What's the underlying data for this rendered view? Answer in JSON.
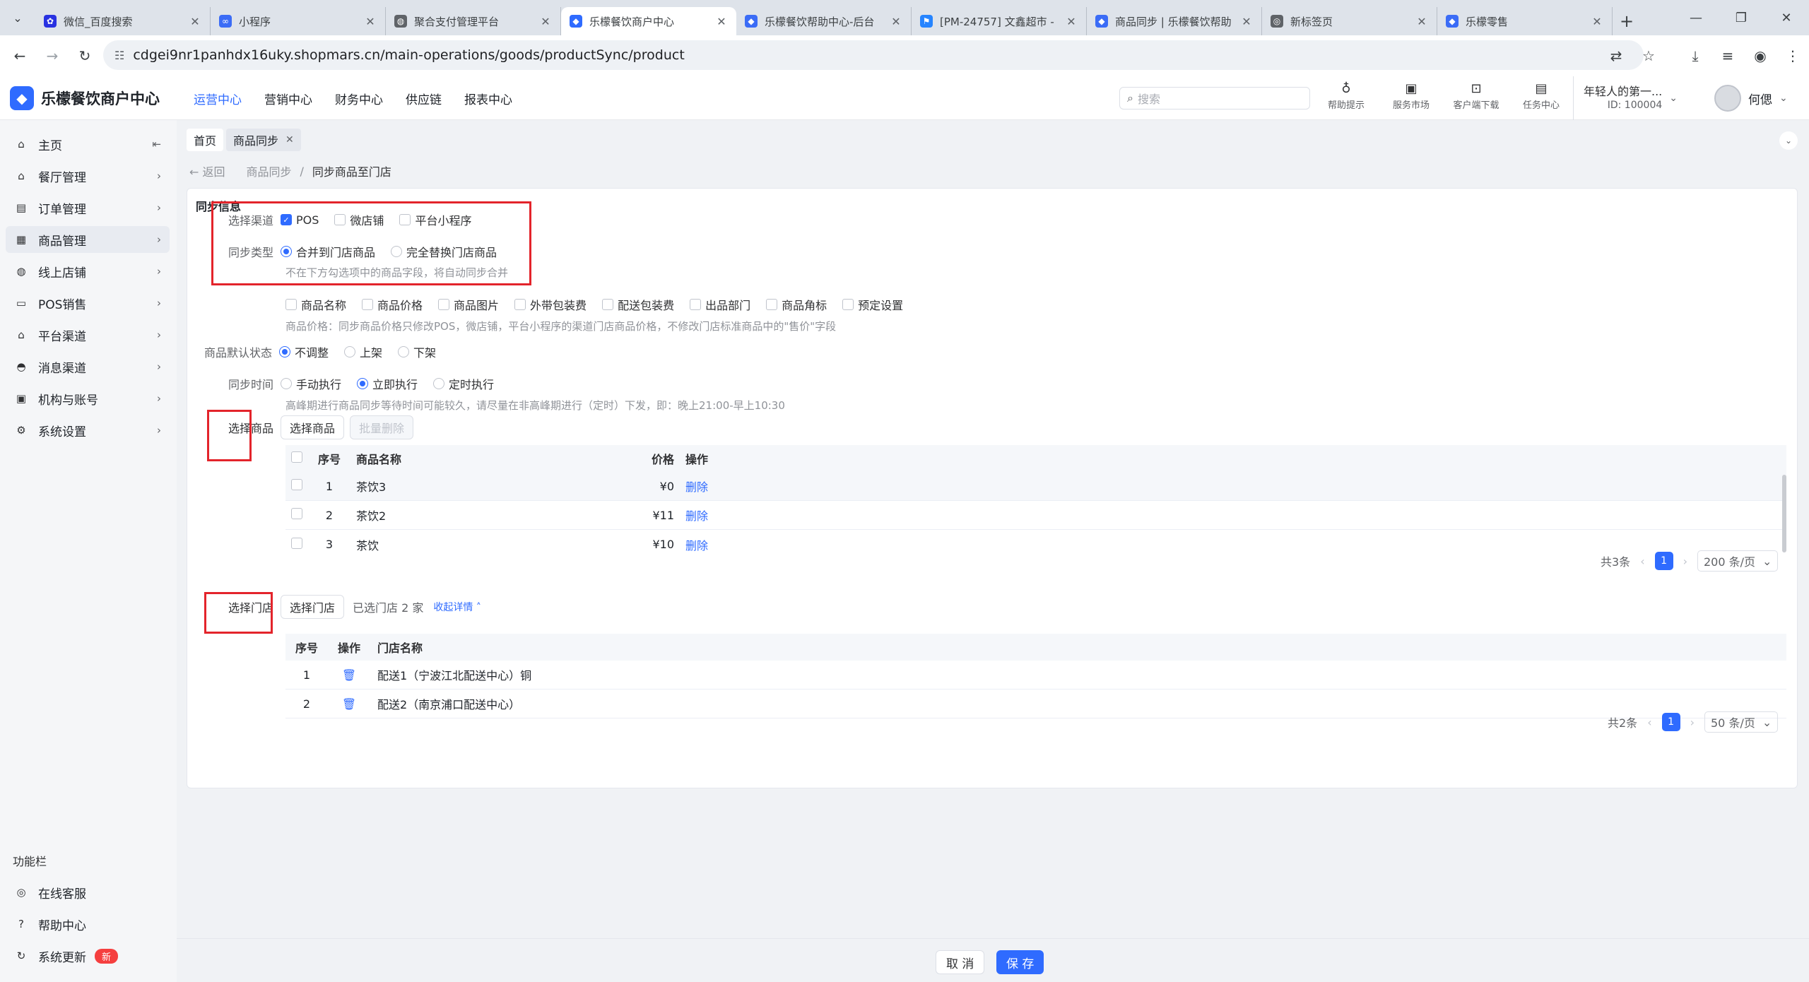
{
  "browser": {
    "tabs": [
      {
        "title": "微信_百度搜索",
        "icon": "paw-icon",
        "color": "#2932e1"
      },
      {
        "title": "小程序",
        "icon": "link-icon",
        "color": "#3b6cf6"
      },
      {
        "title": "聚合支付管理平台",
        "icon": "globe-icon",
        "color": "#5f6368"
      },
      {
        "title": "乐檬餐饮商户中心",
        "icon": "brand-icon",
        "color": "#2f6bff"
      },
      {
        "title": "乐檬餐饮帮助中心-后台",
        "icon": "diamond-icon",
        "color": "#3b6cf6"
      },
      {
        "title": "[PM-24757] 文鑫超市 -",
        "icon": "jira-icon",
        "color": "#2684ff"
      },
      {
        "title": "商品同步 | 乐檬餐饮帮助",
        "icon": "diamond-icon",
        "color": "#3b6cf6"
      },
      {
        "title": "新标签页",
        "icon": "chrome-icon",
        "color": "#5f6368"
      },
      {
        "title": "乐檬零售",
        "icon": "diamond-icon",
        "color": "#3b6cf6"
      }
    ],
    "url": "cdgei9nr1panhdx16uky.shopmars.cn/main-operations/goods/productSync/product"
  },
  "header": {
    "brand": "乐檬餐饮商户中心",
    "nav": [
      "运营中心",
      "营销中心",
      "财务中心",
      "供应链",
      "报表中心"
    ],
    "search_placeholder": "搜索",
    "tools": [
      "帮助提示",
      "服务市场",
      "客户端下载",
      "任务中心"
    ],
    "account_name": "年轻人的第一...",
    "account_id": "ID: 100004",
    "user": "何偲"
  },
  "sidebar": {
    "items": [
      "主页",
      "餐厅管理",
      "订单管理",
      "商品管理",
      "线上店铺",
      "POS销售",
      "平台渠道",
      "消息渠道",
      "机构与账号",
      "系统设置"
    ],
    "footer_label": "功能栏",
    "footer_items": [
      "在线客服",
      "帮助中心",
      "系统更新"
    ],
    "badge_new": "新"
  },
  "page": {
    "tabs": [
      "首页",
      "商品同步"
    ],
    "back": "返回",
    "breadcrumb_parent": "商品同步",
    "breadcrumb_sep": "/",
    "breadcrumb_current": "同步商品至门店",
    "section_title": "同步信息",
    "channel_label": "选择渠道",
    "channels": [
      "POS",
      "微店铺",
      "平台小程序"
    ],
    "sync_type_label": "同步类型",
    "sync_types": [
      "合并到门店商品",
      "完全替换门店商品"
    ],
    "sync_type_hint": "不在下方勾选项中的商品字段，将自动同步合并",
    "fields": [
      "商品名称",
      "商品价格",
      "商品图片",
      "外带包装费",
      "配送包装费",
      "出品部门",
      "商品角标",
      "预定设置"
    ],
    "fields_hint": "商品价格：同步商品价格只修改POS，微店铺，平台小程序的渠道门店商品价格，不修改门店标准商品中的\"售价\"字段",
    "status_label": "商品默认状态",
    "status_options": [
      "不调整",
      "上架",
      "下架"
    ],
    "time_label": "同步时间",
    "time_options": [
      "手动执行",
      "立即执行",
      "定时执行"
    ],
    "time_hint": "高峰期进行商品同步等待时间可能较久，请尽量在非高峰期进行（定时）下发，即：晚上21:00-早上10:30",
    "goods_label": "选择商品",
    "goods_btn": "选择商品",
    "batch_delete": "批量删除",
    "goods_columns": [
      "序号",
      "商品名称",
      "价格",
      "操作"
    ],
    "goods_rows": [
      {
        "no": "1",
        "name": "茶饮3",
        "price": "¥0",
        "op": "删除"
      },
      {
        "no": "2",
        "name": "茶饮2",
        "price": "¥11",
        "op": "删除"
      },
      {
        "no": "3",
        "name": "茶饮",
        "price": "¥10",
        "op": "删除"
      }
    ],
    "goods_total": "共3条",
    "goods_page": "1",
    "goods_page_size": "200 条/页",
    "store_label": "选择门店",
    "store_btn": "选择门店",
    "store_selected": "已选门店 2 家",
    "store_toggle": "收起详情",
    "store_columns": [
      "序号",
      "操作",
      "门店名称"
    ],
    "store_rows": [
      {
        "no": "1",
        "name": "配送1（宁波江北配送中心）铜"
      },
      {
        "no": "2",
        "name": "配送2（南京浦口配送中心）"
      }
    ],
    "store_total": "共2条",
    "store_page": "1",
    "store_page_size": "50 条/页",
    "cancel": "取 消",
    "save": "保 存"
  },
  "colors": {
    "primary": "#2f6bff",
    "annotation": "#e3242b",
    "badge": "#f53f3f"
  }
}
